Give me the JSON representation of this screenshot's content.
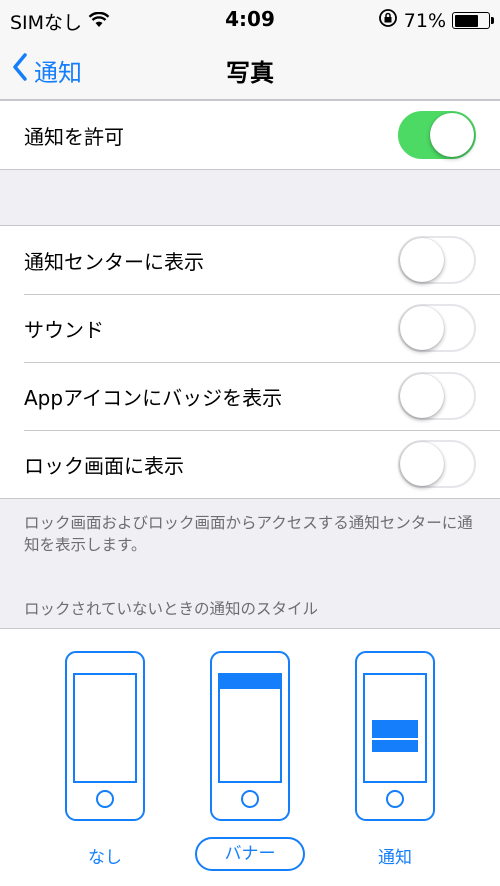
{
  "status_bar": {
    "carrier": "SIMなし",
    "time": "4:09",
    "battery_percent": "71%",
    "battery_level": 0.71
  },
  "nav": {
    "back_label": "通知",
    "title": "写真"
  },
  "allow": {
    "label": "通知を許可",
    "on": true
  },
  "options": [
    {
      "label": "通知センターに表示",
      "on": false
    },
    {
      "label": "サウンド",
      "on": false
    },
    {
      "label": "Appアイコンにバッジを表示",
      "on": false
    },
    {
      "label": "ロック画面に表示",
      "on": false
    }
  ],
  "footer_note": "ロック画面およびロック画面からアクセスする通知センターに通知を表示します。",
  "styles_header": "ロックされていないときの通知のスタイル",
  "styles": [
    {
      "label": "なし",
      "selected": false
    },
    {
      "label": "バナー",
      "selected": true
    },
    {
      "label": "通知",
      "selected": false
    }
  ],
  "colors": {
    "accent": "#157efb",
    "toggle_on": "#4cd964",
    "background": "#efeff4"
  }
}
